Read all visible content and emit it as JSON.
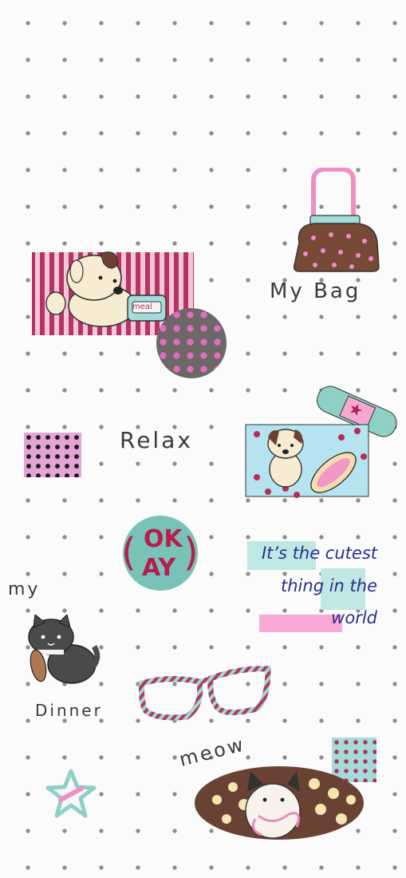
{
  "stickers": {
    "my_bag": "My Bag",
    "relax": "Relax",
    "meal": "meal",
    "okay_top": "OK",
    "okay_bottom": "AY",
    "my": "my",
    "dinner": "Dinner",
    "meow": "meow"
  },
  "quote": {
    "line1": "It’s the cutest",
    "line2": "thing in the",
    "line3": "world"
  }
}
